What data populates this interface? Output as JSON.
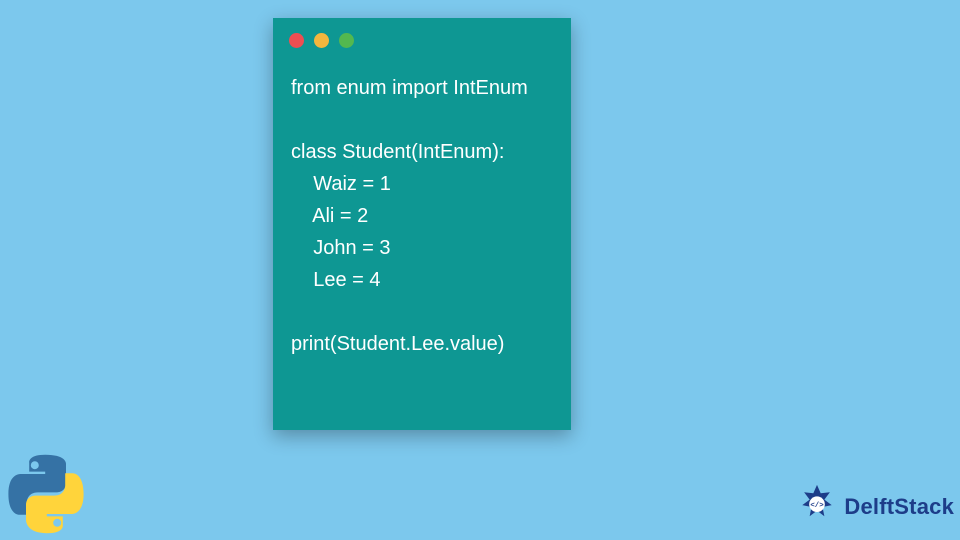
{
  "code": {
    "lines": [
      "from enum import IntEnum",
      "",
      "class Student(IntEnum):",
      "    Waiz = 1",
      "    Ali = 2",
      "    John = 3",
      "    Lee = 4",
      "",
      "print(Student.Lee.value)"
    ]
  },
  "brand": {
    "name": "DelftStack"
  },
  "colors": {
    "background": "#7cc8ed",
    "card": "#0e9793",
    "brand_text": "#1d3d89",
    "dot_red": "#ee4e52",
    "dot_yellow": "#f3b63e",
    "dot_green": "#53b84f"
  }
}
